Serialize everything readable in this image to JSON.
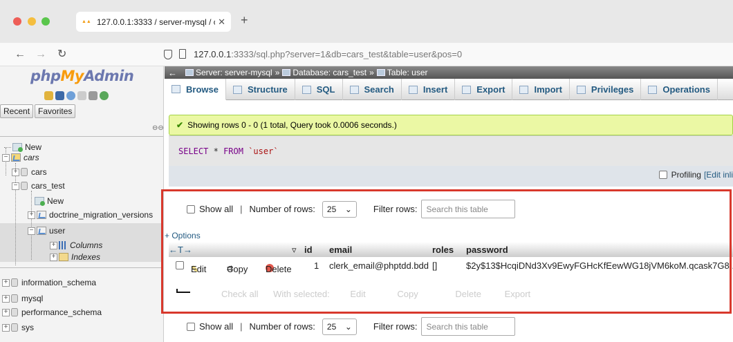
{
  "browser": {
    "tab_title": "127.0.0.1:3333 / server-mysql / c",
    "url_host": "127.0.0.1",
    "url_rest": ":3333/sql.php?server=1&db=cars_test&table=user&pos=0"
  },
  "sidebar": {
    "logo_php": "php",
    "logo_my": "My",
    "logo_admin": "Admin",
    "recent": "Recent",
    "favorites": "Favorites",
    "tree": {
      "new": "New",
      "cars_db": "cars",
      "cars_child": "cars",
      "cars_test": "cars_test",
      "new2": "New",
      "doctrine": "doctrine_migration_versions",
      "user": "user",
      "columns": "Columns",
      "indexes": "Indexes",
      "information_schema": "information_schema",
      "mysql": "mysql",
      "performance_schema": "performance_schema",
      "sys": "sys"
    }
  },
  "breadcrumb": {
    "server": "Server: server-mysql",
    "database": "Database: cars_test",
    "table": "Table: user"
  },
  "tabs": [
    "Browse",
    "Structure",
    "SQL",
    "Search",
    "Insert",
    "Export",
    "Import",
    "Privileges",
    "Operations"
  ],
  "message": "Showing rows 0 - 0 (1 total, Query took 0.0006 seconds.)",
  "sql": {
    "select": "SELECT",
    "star": "*",
    "from": "FROM",
    "table": "`user`"
  },
  "profiling": {
    "label": "Profiling",
    "edit": "[Edit inli"
  },
  "nav": {
    "show_all": "Show all",
    "number_of_rows": "Number of rows:",
    "rows_value": "25",
    "filter_rows": "Filter rows:",
    "search_placeholder": "Search this table"
  },
  "options": "+ Options",
  "columns": [
    "id",
    "email",
    "roles",
    "password"
  ],
  "row": {
    "edit": "Edit",
    "copy": "Copy",
    "delete": "Delete",
    "id": "1",
    "email": "clerk_email@phptdd.bdd",
    "roles": "[]",
    "password": "$2y$13$HcqiDNd3Xv9EwyFGHcKfEewWG18jVM6koM.qcask7G8..."
  },
  "bottom_actions": {
    "check_all": "Check all",
    "with_selected": "With selected:",
    "edit": "Edit",
    "copy": "Copy",
    "delete": "Delete",
    "export": "Export"
  },
  "colors": {
    "highlight_border": "#d8382c",
    "success_bg": "#ebf8a4",
    "link": "#235a81"
  }
}
